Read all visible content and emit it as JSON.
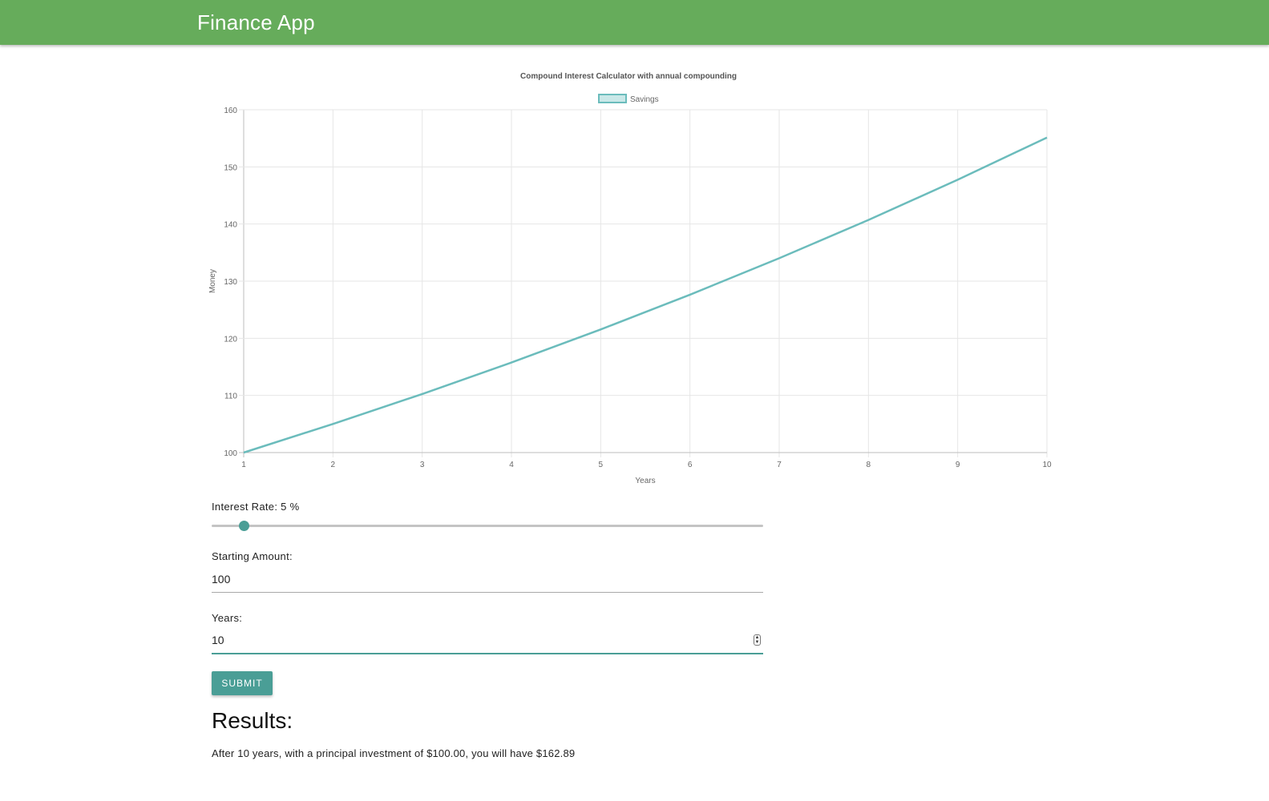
{
  "app": {
    "title": "Finance App"
  },
  "form": {
    "interest_label": "Interest Rate:",
    "interest_value": "5",
    "interest_unit": "%",
    "interest_slider_fraction": 0.0588,
    "starting_label": "Starting Amount:",
    "starting_value": "100",
    "years_label": "Years:",
    "years_value": "10",
    "submit_label": "SUBMIT"
  },
  "results": {
    "heading": "Results:",
    "text": "After 10 years, with a principal investment of $100.00, you will have $162.89"
  },
  "colors": {
    "navbar": "#66ac5b",
    "accent": "#4a9e96",
    "line": "#6bbcbc",
    "legend_fill": "#c9e8e8"
  },
  "chart_data": {
    "type": "line",
    "title": "Compound Interest Calculator with annual compounding",
    "xlabel": "Years",
    "ylabel": "Money",
    "x": [
      1,
      2,
      3,
      4,
      5,
      6,
      7,
      8,
      9,
      10
    ],
    "series": [
      {
        "name": "Savings",
        "values": [
          100,
          105,
          110.25,
          115.76,
          121.55,
          127.63,
          134.01,
          140.71,
          147.75,
          155.13
        ]
      }
    ],
    "xticks": [
      "1",
      "2",
      "3",
      "4",
      "5",
      "6",
      "7",
      "8",
      "9",
      "10"
    ],
    "yticks": [
      "100",
      "110",
      "120",
      "130",
      "140",
      "150",
      "160"
    ],
    "xlim": [
      1,
      10
    ],
    "ylim": [
      100,
      160
    ],
    "grid": true,
    "legend_position": "top-center"
  }
}
